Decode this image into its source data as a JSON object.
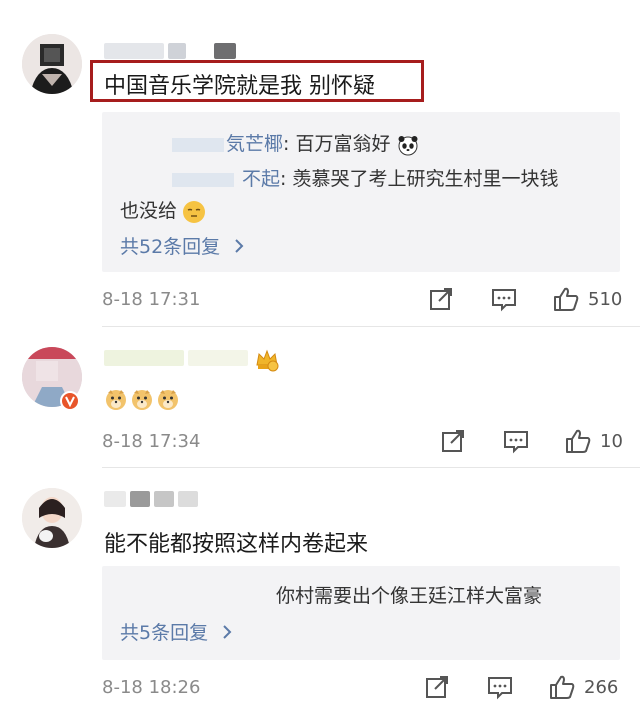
{
  "comments": [
    {
      "text": "中国音乐学院就是我 别怀疑",
      "replies": [
        {
          "user": "気芒椰",
          "sep": ":",
          "text": " 百万富翁好"
        },
        {
          "user": "不起",
          "sep": ":",
          "text": " 羡慕哭了考上研究生村里一块钱",
          "text2": "也没给"
        }
      ],
      "more_replies": "共52条回复",
      "timestamp": "8-18 17:31",
      "likes": "510"
    },
    {
      "text": "",
      "timestamp": "8-18 17:34",
      "likes": "10"
    },
    {
      "text": "能不能都按照这样内卷起来",
      "replies": [
        {
          "text": "你村需要出个像王廷江样大富豪"
        }
      ],
      "more_replies": "共5条回复",
      "timestamp": "8-18 18:26",
      "likes": "266"
    }
  ],
  "colors": {
    "highlight_border": "#a61d1d",
    "link_blue": "#5b7aa8",
    "reply_bg": "#f3f3f5",
    "vip_badge": "#e8a319",
    "verified_badge": "#e8552a"
  },
  "icons": {
    "share": "share-icon",
    "comment": "comment-icon",
    "like": "like-icon",
    "more": "chevron-right-icon"
  }
}
